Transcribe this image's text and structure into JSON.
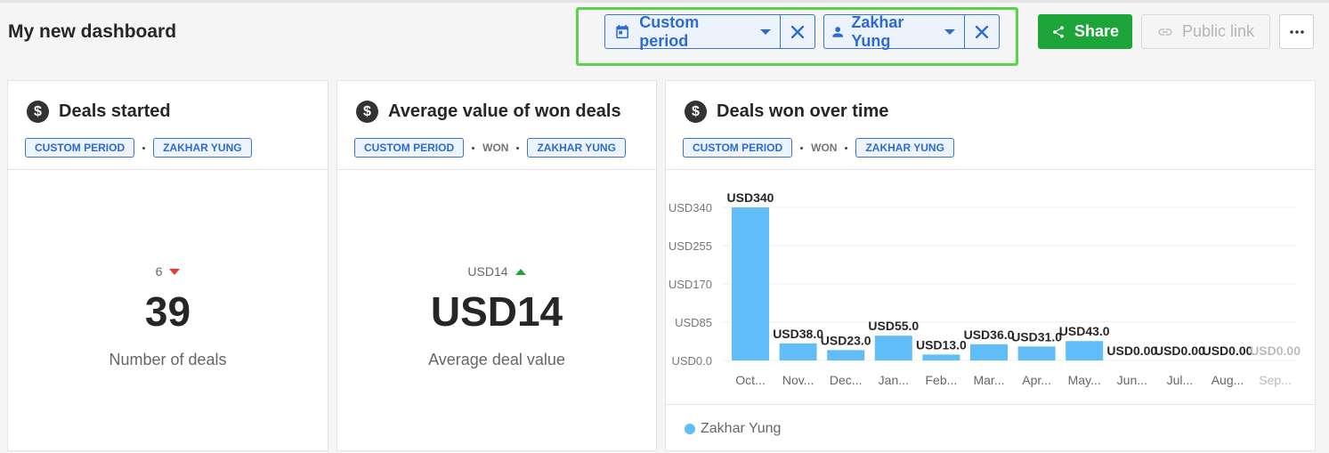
{
  "dashboard": {
    "title": "My new dashboard"
  },
  "filters": {
    "period": {
      "label": "Custom period",
      "icon": "calendar-icon"
    },
    "user": {
      "label": "Zakhar Yung",
      "icon": "person-icon"
    }
  },
  "toolbar": {
    "share_label": "Share",
    "public_link_label": "Public link",
    "more_label": "•••"
  },
  "cards": [
    {
      "title": "Deals started",
      "tags": [
        "CUSTOM PERIOD",
        "ZAKHAR YUNG"
      ],
      "delta": "6",
      "delta_direction": "down",
      "value": "39",
      "label": "Number of deals"
    },
    {
      "title": "Average value of won deals",
      "tags": [
        "CUSTOM PERIOD",
        "WON",
        "ZAKHAR YUNG"
      ],
      "delta": "USD14",
      "delta_direction": "up",
      "value": "USD14",
      "label": "Average deal value"
    },
    {
      "title": "Deals won over time",
      "tags": [
        "CUSTOM PERIOD",
        "WON",
        "ZAKHAR YUNG"
      ]
    }
  ],
  "colors": {
    "accent": "#2c6ad6",
    "share": "#1da539",
    "bar": "#61bdf7",
    "highlight": "#59d34b"
  },
  "chart_data": {
    "type": "bar",
    "categories": [
      "Oct...",
      "Nov...",
      "Dec...",
      "Jan...",
      "Feb...",
      "Mar...",
      "Apr...",
      "May...",
      "Jun...",
      "Jul...",
      "Aug...",
      "Sep..."
    ],
    "series": [
      {
        "name": "Zakhar Yung",
        "values": [
          340,
          38,
          23,
          55,
          13,
          36,
          31,
          43,
          0,
          0,
          0,
          0
        ]
      }
    ],
    "data_labels": [
      "USD340",
      "USD38.0",
      "USD23.0",
      "USD55.0",
      "USD13.0",
      "USD36.0",
      "USD31.0",
      "USD43.0",
      "USD0.00",
      "USD0.00",
      "USD0.00",
      "USD0.00"
    ],
    "y_ticks": [
      "USD0.0",
      "USD85",
      "USD170",
      "USD255",
      "USD340"
    ],
    "y_tick_values": [
      0,
      85,
      170,
      255,
      340
    ],
    "ylim": [
      0,
      340
    ],
    "grid": true,
    "legend": "bottom-left"
  }
}
